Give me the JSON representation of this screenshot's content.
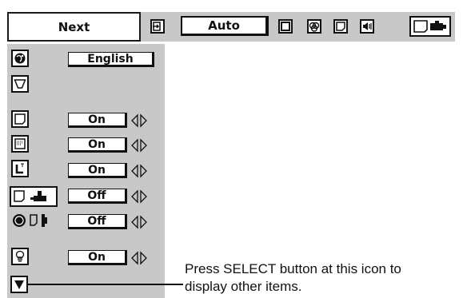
{
  "toolbar": {
    "next_label": "Next",
    "mode_label": "Auto",
    "icons": [
      "input-icon",
      "screen-icon",
      "image-adjust-icon",
      "image-icon",
      "sound-icon",
      "setting-icon"
    ]
  },
  "settings": {
    "language_value": "English",
    "rows": [
      {
        "icon": "language-icon",
        "value": "English"
      },
      {
        "icon": "keystone-icon",
        "value": ""
      },
      {
        "icon": "blue-back-icon",
        "value": "On"
      },
      {
        "icon": "display-icon",
        "value": "On"
      },
      {
        "icon": "logo-icon",
        "value": "On"
      },
      {
        "icon": "ceiling-icon",
        "value": "Off"
      },
      {
        "icon": "rear-icon",
        "value": "Off"
      },
      {
        "icon": "lamp-icon",
        "value": "On"
      }
    ]
  },
  "caption": {
    "line1": "Press SELECT button at this icon to",
    "line2": "display other items."
  },
  "colors": {
    "panel_bg": "#c8c8c8",
    "box_bg": "#ffffff",
    "ink": "#111111"
  }
}
